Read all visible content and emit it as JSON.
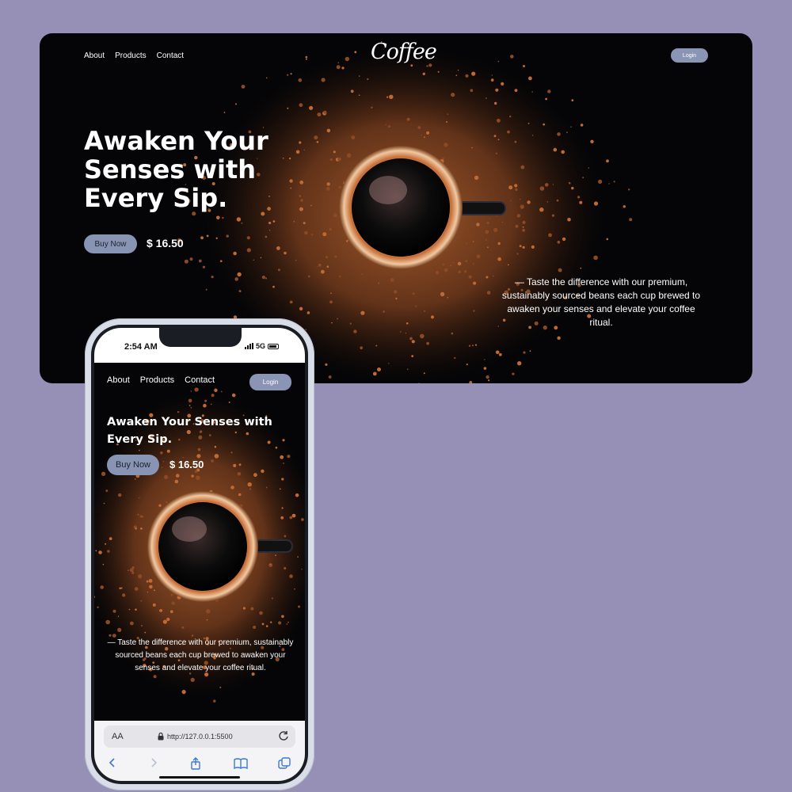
{
  "colors": {
    "background": "#9690b7",
    "accent_button": "#8794b3",
    "hero_bg": "#050507",
    "coffee_crumbs": "#b0622f"
  },
  "desktop": {
    "nav": [
      "About",
      "Products",
      "Contact"
    ],
    "logo": "Coffee",
    "login_label": "Login",
    "headline": "Awaken Your Senses with Every Sip.",
    "buy_label": "Buy Now",
    "price": "$ 16.50",
    "tagline": "— Taste the difference with our premium, sustainably sourced beans each cup brewed to awaken your senses and elevate your coffee ritual."
  },
  "mobile": {
    "status": {
      "time": "2:54 AM",
      "network": "5G"
    },
    "nav": [
      "About",
      "Products",
      "Contact"
    ],
    "login_label": "Login",
    "headline": "Awaken Your Senses with Every Sip.",
    "buy_label": "Buy Now",
    "price": "$ 16.50",
    "tagline": "— Taste the difference with our premium, sustainably sourced beans each cup brewed to awaken your senses and elevate your coffee ritual.",
    "browser": {
      "aa_label": "AA",
      "url": "http://127.0.0.1:5500",
      "toolbar_icons": [
        "back-icon",
        "forward-icon",
        "share-icon",
        "bookmarks-icon",
        "tabs-icon"
      ]
    }
  }
}
